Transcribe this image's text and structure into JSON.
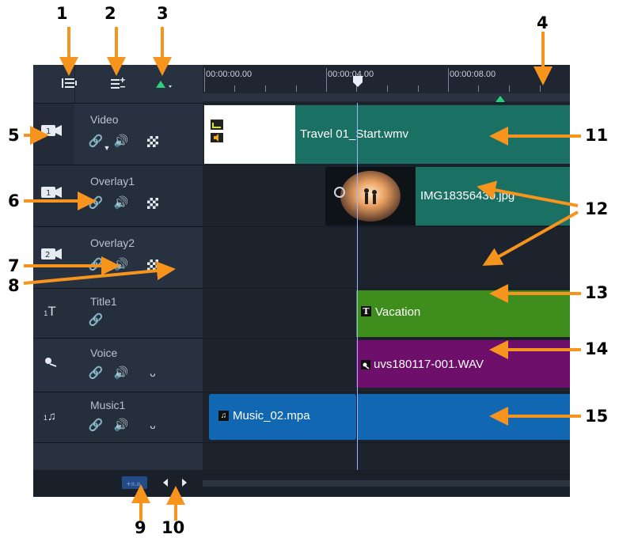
{
  "callouts": [
    "1",
    "2",
    "3",
    "4",
    "5",
    "6",
    "7",
    "8",
    "9",
    "10",
    "11",
    "12",
    "13",
    "14",
    "15"
  ],
  "ruler": {
    "timecodes": [
      "00:00:00.00",
      "00:00:04.00",
      "00:00:08.00"
    ]
  },
  "tracks": [
    {
      "name": "Video",
      "icon": "video-track-icon"
    },
    {
      "name": "Overlay1",
      "icon": "overlay1-track-icon"
    },
    {
      "name": "Overlay2",
      "icon": "overlay2-track-icon"
    },
    {
      "name": "Title1",
      "icon": "title-track-icon",
      "badge": "1"
    },
    {
      "name": "Voice",
      "icon": "voice-track-icon"
    },
    {
      "name": "Music1",
      "icon": "music-track-icon",
      "badge": "1"
    }
  ],
  "clips": {
    "video": "Travel 01_Start.wmv",
    "overlay": "IMG18356430.jpg",
    "title": "Vacation",
    "voice": "uvs180117-001.WAV",
    "music": "Music_02.mpa"
  },
  "colors": {
    "accent_orange": "#f7941d",
    "video_clip": "#1a7062",
    "title_clip": "#3f8d1c",
    "voice_clip": "#6e0f6b",
    "music_clip": "#1167b1",
    "playhead": "#9db5ff",
    "marker_green": "#27d27d"
  }
}
